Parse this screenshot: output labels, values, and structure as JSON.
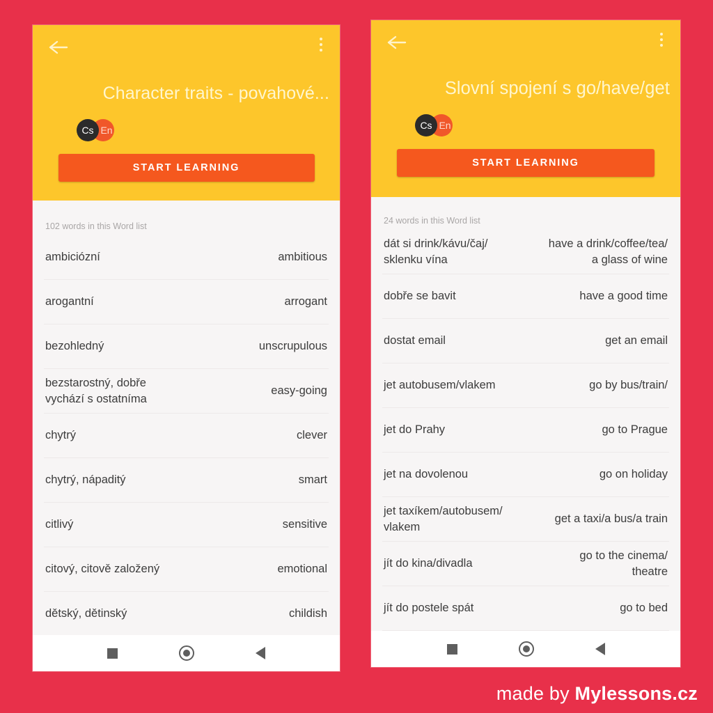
{
  "background_color": "#E8304A",
  "accent_colors": {
    "header_yellow": "#FDC62B",
    "button_orange": "#F5581E",
    "list_background": "#F7F5F5",
    "title_text": "#FFF6CE"
  },
  "watermark": {
    "prefix": "made by ",
    "brand": "Mylessons.cz"
  },
  "phones": [
    {
      "id": "left",
      "header": {
        "back_icon": "arrow-left-icon",
        "menu_icon": "overflow-menu-icon",
        "title": "Character traits - povahové...",
        "badges": [
          {
            "label": "Cs",
            "color": "#2B2B2B"
          },
          {
            "label": "En",
            "color": "#F0572A"
          }
        ],
        "start_button": "START LEARNING"
      },
      "list": {
        "count_label": "102 words in this Word list",
        "rows": [
          {
            "cz": "ambiciózní",
            "en": "ambitious"
          },
          {
            "cz": "arogantní",
            "en": "arrogant"
          },
          {
            "cz": "bezohledný",
            "en": "unscrupulous"
          },
          {
            "cz": "bezstarostný, dobře vychází s ostatníma",
            "en": "easy-going"
          },
          {
            "cz": "chytrý",
            "en": "clever"
          },
          {
            "cz": "chytrý, nápaditý",
            "en": "smart"
          },
          {
            "cz": "citlivý",
            "en": "sensitive"
          },
          {
            "cz": "citový, citově založený",
            "en": "emotional"
          },
          {
            "cz": "dětský, dětinský",
            "en": "childish"
          }
        ]
      },
      "navbar": {
        "recents": "square-recents-icon",
        "home": "circle-home-icon",
        "back": "triangle-back-icon"
      }
    },
    {
      "id": "right",
      "header": {
        "back_icon": "arrow-left-icon",
        "menu_icon": "overflow-menu-icon",
        "title": "Slovní spojení s  go/have/get",
        "badges": [
          {
            "label": "Cs",
            "color": "#2B2B2B"
          },
          {
            "label": "En",
            "color": "#F0572A"
          }
        ],
        "start_button": "START LEARNING"
      },
      "list": {
        "count_label": "24 words in this Word list",
        "rows": [
          {
            "cz": "dát si drink/kávu/čaj/ sklenku vína",
            "en": "have a drink/coffee/tea/\na glass of wine"
          },
          {
            "cz": "dobře se bavit",
            "en": "have a good time"
          },
          {
            "cz": "dostat email",
            "en": "get an email"
          },
          {
            "cz": "jet autobusem/vlakem",
            "en": "go by bus/train/"
          },
          {
            "cz": "jet do Prahy",
            "en": "go to Prague"
          },
          {
            "cz": "jet na dovolenou",
            "en": "go on holiday"
          },
          {
            "cz": "jet taxíkem/autobusem/ vlakem",
            "en": "get a taxi/a bus/a train"
          },
          {
            "cz": "jít do kina/divadla",
            "en": "go to the cinema/\ntheatre"
          },
          {
            "cz": "jít do postele spát",
            "en": "go to bed"
          }
        ]
      },
      "navbar": {
        "recents": "square-recents-icon",
        "home": "circle-home-icon",
        "back": "triangle-back-icon"
      }
    }
  ]
}
